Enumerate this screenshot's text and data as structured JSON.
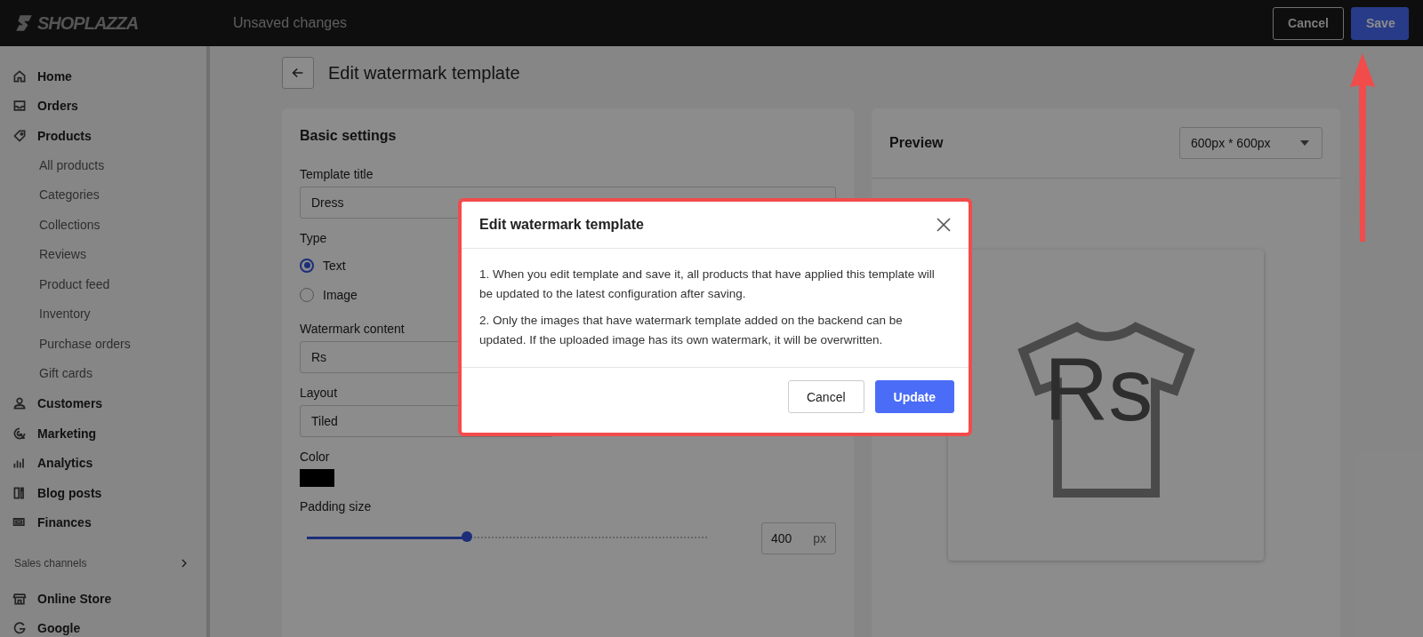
{
  "topbar": {
    "logo": "SHOPLAZZA",
    "status": "Unsaved changes",
    "buttons": [
      {
        "label": "Cancel",
        "kind": "secondary"
      },
      {
        "label": "Save",
        "kind": "primary"
      }
    ]
  },
  "sidebar": {
    "items": [
      {
        "label": "Home"
      },
      {
        "label": "Orders"
      },
      {
        "label": "Products",
        "children": [
          {
            "label": "All products"
          },
          {
            "label": "Categories"
          },
          {
            "label": "Collections"
          },
          {
            "label": "Reviews"
          },
          {
            "label": "Product feed"
          },
          {
            "label": "Inventory"
          },
          {
            "label": "Purchase orders"
          },
          {
            "label": "Gift cards"
          }
        ]
      },
      {
        "label": "Customers"
      },
      {
        "label": "Marketing"
      },
      {
        "label": "Analytics"
      },
      {
        "label": "Blog posts"
      },
      {
        "label": "Finances"
      }
    ],
    "section": "Sales channels",
    "channels": [
      {
        "label": "Online Store"
      },
      {
        "label": "Google"
      }
    ]
  },
  "page": {
    "title": "Edit watermark template"
  },
  "basic_settings": {
    "title": "Basic settings",
    "template_title": {
      "label": "Template title",
      "value": "Dress"
    },
    "type": {
      "label": "Type",
      "options": [
        {
          "label": "Text",
          "selected": true
        },
        {
          "label": "Image",
          "selected": false
        }
      ]
    },
    "watermark_content": {
      "label": "Watermark content",
      "value": "Rs"
    },
    "layout": {
      "label": "Layout",
      "value": "Tiled"
    },
    "color": {
      "label": "Color",
      "color": "#000000"
    },
    "padding": {
      "label": "Padding size",
      "level": 0.4,
      "value": "400",
      "unit": "px"
    }
  },
  "preview": {
    "title": "Preview",
    "size": "600px * 600px",
    "watermark_text": "Rs"
  },
  "dialog": {
    "title": "Edit watermark template",
    "paragraphs": [
      "1. When you edit template and save it, all products that have applied this template will be updated to the latest configuration after saving.",
      "2. Only the images that have watermark template added on the backend can be updated. If the uploaded image has its own watermark, it will be overwritten."
    ],
    "buttons": [
      {
        "label": "Cancel",
        "kind": "secondary"
      },
      {
        "label": "Update",
        "kind": "primary"
      }
    ]
  }
}
